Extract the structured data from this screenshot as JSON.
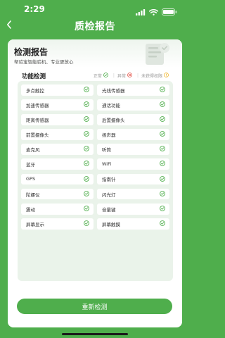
{
  "status_bar": {
    "time": "2:29"
  },
  "nav": {
    "title": "质检报告",
    "back_icon": "chevron-left-icon"
  },
  "report": {
    "title": "检测报告",
    "subtitle": "帮验宝智能验机、专业更放心"
  },
  "section": {
    "title": "功能检测",
    "legend": [
      {
        "label": "正常",
        "icon": "check-circle-icon",
        "color": "#4fae4c"
      },
      {
        "label": "异常",
        "icon": "cross-circle-icon",
        "color": "#e65a50"
      },
      {
        "label": "未获得权限",
        "icon": "warning-circle-icon",
        "color": "#f0b429"
      }
    ]
  },
  "items": [
    {
      "label": "多点触控",
      "status": "正常"
    },
    {
      "label": "光线传感器",
      "status": "正常"
    },
    {
      "label": "加速传感器",
      "status": "正常"
    },
    {
      "label": "通话功能",
      "status": "正常"
    },
    {
      "label": "距离传感器",
      "status": "正常"
    },
    {
      "label": "后置摄像头",
      "status": "正常"
    },
    {
      "label": "前置摄像头",
      "status": "正常"
    },
    {
      "label": "扬声器",
      "status": "正常"
    },
    {
      "label": "麦克风",
      "status": "正常"
    },
    {
      "label": "听筒",
      "status": "正常"
    },
    {
      "label": "蓝牙",
      "status": "正常"
    },
    {
      "label": "WiFi",
      "status": "正常"
    },
    {
      "label": "GPS",
      "status": "正常"
    },
    {
      "label": "指南针",
      "status": "正常"
    },
    {
      "label": "陀螺仪",
      "status": "正常"
    },
    {
      "label": "闪光灯",
      "status": "正常"
    },
    {
      "label": "震动",
      "status": "正常"
    },
    {
      "label": "音量键",
      "status": "正常"
    },
    {
      "label": "屏幕显示",
      "status": "正常"
    },
    {
      "label": "屏幕触摸",
      "status": "正常"
    }
  ],
  "actions": {
    "retest_label": "重新检测"
  },
  "colors": {
    "brand": "#4fae4c",
    "panel": "#eaf3ea"
  }
}
